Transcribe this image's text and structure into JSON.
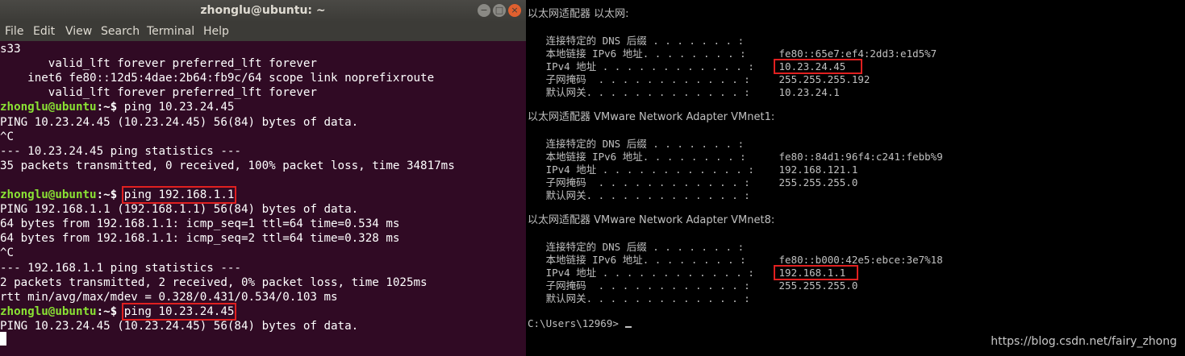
{
  "ubuntu": {
    "title": "zhonglu@ubuntu: ~",
    "window_buttons": {
      "minimize": "−",
      "maximize": "□",
      "close": "×"
    },
    "menu": [
      "File",
      "Edit",
      "View",
      "Search",
      "Terminal",
      "Help"
    ],
    "lines": [
      {
        "text": "s33"
      },
      {
        "text": "       valid_lft forever preferred_lft forever"
      },
      {
        "text": "    inet6 fe80::12d5:4dae:2b64:fb9c/64 scope link noprefixroute"
      },
      {
        "text": "       valid_lft forever preferred_lft forever"
      },
      {
        "prompt": "zhonglu@ubuntu",
        "path": ":~$ ",
        "cmd": "ping 10.23.24.45"
      },
      {
        "text": "PING 10.23.24.45 (10.23.24.45) 56(84) bytes of data."
      },
      {
        "text": "^C"
      },
      {
        "text": "--- 10.23.24.45 ping statistics ---"
      },
      {
        "text": "35 packets transmitted, 0 received, 100% packet loss, time 34817ms"
      },
      {
        "text": ""
      },
      {
        "prompt": "zhonglu@ubuntu",
        "path": ":~$ ",
        "cmd": "ping 192.168.1.1",
        "highlight": true
      },
      {
        "text": "PING 192.168.1.1 (192.168.1.1) 56(84) bytes of data."
      },
      {
        "text": "64 bytes from 192.168.1.1: icmp_seq=1 ttl=64 time=0.534 ms"
      },
      {
        "text": "64 bytes from 192.168.1.1: icmp_seq=2 ttl=64 time=0.328 ms"
      },
      {
        "text": "^C"
      },
      {
        "text": "--- 192.168.1.1 ping statistics ---"
      },
      {
        "text": "2 packets transmitted, 2 received, 0% packet loss, time 1025ms"
      },
      {
        "text": "rtt min/avg/max/mdev = 0.328/0.431/0.534/0.103 ms"
      },
      {
        "prompt": "zhonglu@ubuntu",
        "path": ":~$ ",
        "cmd": "ping 10.23.24.45",
        "highlight": true
      },
      {
        "text": "PING 10.23.24.45 (10.23.24.45) 56(84) bytes of data."
      }
    ]
  },
  "cmd": {
    "adapters": [
      {
        "header": "以太网适配器 以太网:",
        "rows": [
          {
            "label": "   连接特定的 DNS 后缀 . . . . . . . :",
            "value": ""
          },
          {
            "label": "   本地链接 IPv6 地址. . . . . . . . :",
            "value": " fe80::65e7:ef4:2dd3:e1d5%7"
          },
          {
            "label": "   IPv4 地址 . . . . . . . . . . . . :",
            "value": " 10.23.24.45",
            "highlight": true
          },
          {
            "label": "   子网掩码  . . . . . . . . . . . . :",
            "value": " 255.255.255.192"
          },
          {
            "label": "   默认网关. . . . . . . . . . . . . :",
            "value": " 10.23.24.1"
          }
        ]
      },
      {
        "header": "以太网适配器 VMware Network Adapter VMnet1:",
        "rows": [
          {
            "label": "   连接特定的 DNS 后缀 . . . . . . . :",
            "value": ""
          },
          {
            "label": "   本地链接 IPv6 地址. . . . . . . . :",
            "value": " fe80::84d1:96f4:c241:febb%9"
          },
          {
            "label": "   IPv4 地址 . . . . . . . . . . . . :",
            "value": " 192.168.121.1"
          },
          {
            "label": "   子网掩码  . . . . . . . . . . . . :",
            "value": " 255.255.255.0"
          },
          {
            "label": "   默认网关. . . . . . . . . . . . . :",
            "value": ""
          }
        ]
      },
      {
        "header": "以太网适配器 VMware Network Adapter VMnet8:",
        "rows": [
          {
            "label": "   连接特定的 DNS 后缀 . . . . . . . :",
            "value": ""
          },
          {
            "label": "   本地链接 IPv6 地址. . . . . . . . :",
            "value": " fe80::b000:42e5:ebce:3e7%18"
          },
          {
            "label": "   IPv4 地址 . . . . . . . . . . . . :",
            "value": " 192.168.1.1",
            "highlight": true
          },
          {
            "label": "   子网掩码  . . . . . . . . . . . . :",
            "value": " 255.255.255.0"
          },
          {
            "label": "   默认网关. . . . . . . . . . . . . :",
            "value": ""
          }
        ]
      }
    ],
    "prompt": "C:\\Users\\12969>",
    "watermark": "https://blog.csdn.net/fairy_zhong"
  }
}
